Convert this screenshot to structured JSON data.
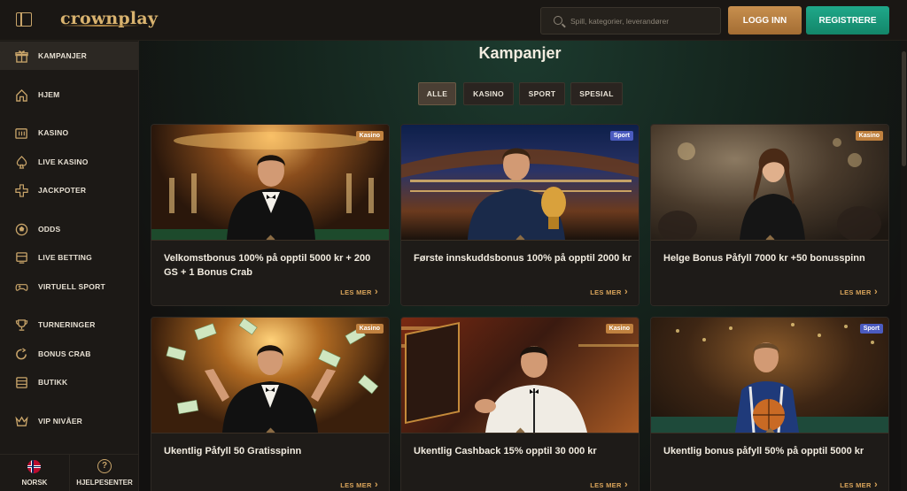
{
  "header": {
    "logo": "crownplay",
    "search_placeholder": "Spill, kategorier, leverandører",
    "login_label": "LOGG INN",
    "register_label": "REGISTRERE"
  },
  "sidebar": {
    "items": [
      {
        "label": "KAMPANJER",
        "icon": "gift-icon"
      },
      {
        "label": "HJEM",
        "icon": "home-icon"
      },
      {
        "label": "KASINO",
        "icon": "slot-machine-icon"
      },
      {
        "label": "LIVE KASINO",
        "icon": "spade-icon"
      },
      {
        "label": "JACKPOTER",
        "icon": "jackpot-icon"
      },
      {
        "label": "ODDS",
        "icon": "ball-icon"
      },
      {
        "label": "LIVE BETTING",
        "icon": "live-betting-icon"
      },
      {
        "label": "VIRTUELL SPORT",
        "icon": "gamepad-icon"
      },
      {
        "label": "TURNERINGER",
        "icon": "trophy-icon"
      },
      {
        "label": "BONUS CRAB",
        "icon": "crab-icon"
      },
      {
        "label": "BUTIKK",
        "icon": "shop-icon"
      },
      {
        "label": "VIP NIVÅER",
        "icon": "crown-icon"
      }
    ],
    "footer": {
      "language": "NORSK",
      "help": "HJELPESENTER"
    }
  },
  "main": {
    "title": "Kampanjer",
    "filters": [
      "ALLE",
      "KASINO",
      "SPORT",
      "SPESIAL"
    ],
    "read_more": "LES MER",
    "cards": [
      {
        "title": "Velkomstbonus 100% på opptil 5000 kr + 200 GS + 1 Bonus Crab",
        "badge": "Kasino"
      },
      {
        "title": "Første innskuddsbonus 100% på opptil 2000 kr",
        "badge": "Sport"
      },
      {
        "title": "Helge Bonus Påfyll 7000 kr +50 bonusspinn",
        "badge": "Kasino"
      },
      {
        "title": "Ukentlig Påfyll 50 Gratisspinn",
        "badge": "Kasino"
      },
      {
        "title": "Ukentlig Cashback 15% opptil 30 000 kr",
        "badge": "Kasino"
      },
      {
        "title": "Ukentlig bonus påfyll 50% på opptil 5000 kr",
        "badge": "Sport"
      }
    ]
  },
  "colors": {
    "accent_gold": "#d9a45a",
    "register_green": "#1fa88a",
    "login_bronze": "#c78f4e"
  }
}
